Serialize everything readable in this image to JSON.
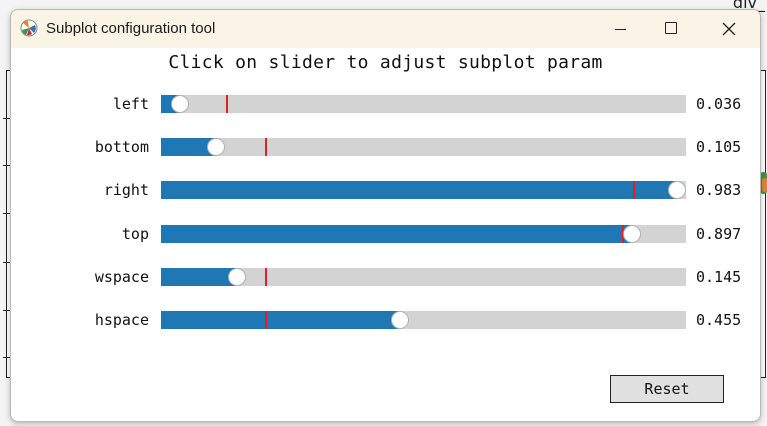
{
  "background_window": {
    "corner_text": "div_"
  },
  "window": {
    "title": "Subplot configuration tool",
    "app_icon": "matplotlib-icon",
    "controls": {
      "minimize": "minimize-icon",
      "maximize": "maximize-icon",
      "close": "close-icon"
    }
  },
  "heading": "Click on slider to adjust subplot param",
  "sliders": [
    {
      "label": "left",
      "value": 0.036,
      "value_text": "0.036",
      "valinit": 0.125
    },
    {
      "label": "bottom",
      "value": 0.105,
      "value_text": "0.105",
      "valinit": 0.2
    },
    {
      "label": "right",
      "value": 0.983,
      "value_text": "0.983",
      "valinit": 0.9
    },
    {
      "label": "top",
      "value": 0.897,
      "value_text": "0.897",
      "valinit": 0.88
    },
    {
      "label": "wspace",
      "value": 0.145,
      "value_text": "0.145",
      "valinit": 0.2
    },
    {
      "label": "hspace",
      "value": 0.455,
      "value_text": "0.455",
      "valinit": 0.2
    }
  ],
  "reset_label": "Reset",
  "colors": {
    "fill": "#1f77b4",
    "track": "#d3d3d3",
    "valinit_marker": "#e02020",
    "titlebar": "#f9f4e6"
  }
}
